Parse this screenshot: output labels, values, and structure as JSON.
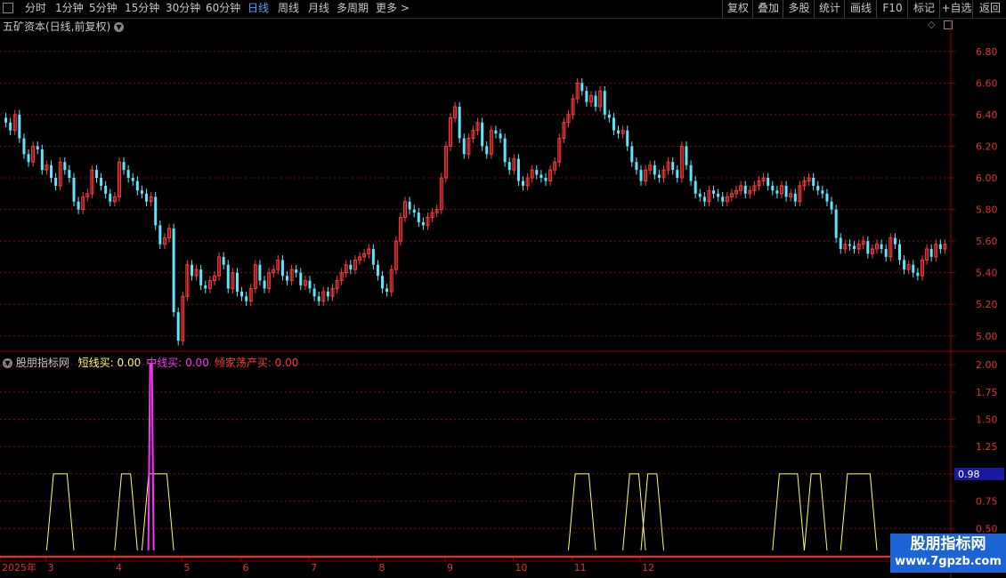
{
  "toolbar": {
    "left_items": [
      "分时",
      "1分钟",
      "5分钟",
      "15分钟",
      "30分钟",
      "60分钟",
      "日线",
      "周线",
      "月线",
      "多周期",
      "更多 >"
    ],
    "active": "日线",
    "right_items": [
      "复权",
      "叠加",
      "多股",
      "统计",
      "画线",
      "F10",
      "标记",
      "+自选",
      "返回"
    ]
  },
  "main_chart": {
    "title": "五矿资本(日线,前复权)",
    "y_ticks": [
      "6.80",
      "6.60",
      "6.40",
      "6.20",
      "6.00",
      "5.80",
      "5.60",
      "5.40",
      "5.20",
      "5.00"
    ],
    "ylim": [
      4.92,
      6.9
    ],
    "up_color": "#ff3b3b",
    "down_color": "#5ee6ff"
  },
  "indicator": {
    "name": "股朋指标网",
    "items": [
      {
        "label": "短线买: 0.00",
        "color": "#ffff66"
      },
      {
        "label": "中线买: 0.00",
        "color": "#ff33ff"
      },
      {
        "label": "倾家荡产买: 0.00",
        "color": "#ff3b3b"
      }
    ],
    "y_ticks": [
      "2.00",
      "1.75",
      "1.50",
      "1.25",
      "1.00",
      "0.75",
      "0.50"
    ],
    "current_value": "0.98",
    "ylim": [
      0.25,
      2.05
    ]
  },
  "x_axis": {
    "labels": [
      "2025年",
      "3",
      "4",
      "5",
      "6",
      "7",
      "8",
      "9",
      "10",
      "11",
      "12"
    ],
    "bar_index": [
      0,
      10,
      25,
      40,
      53,
      68,
      83,
      98,
      113,
      126,
      141
    ]
  },
  "watermark": {
    "name": "股朋指标网",
    "url": "www.7gpzb.com"
  },
  "chart_data": [
    {
      "type": "candlestick",
      "title": "五矿资本(日线,前复权)",
      "ylim": [
        4.92,
        6.9
      ],
      "closes": [
        6.35,
        6.3,
        6.4,
        6.25,
        6.15,
        6.1,
        6.2,
        6.18,
        6.05,
        6.08,
        6.0,
        5.95,
        6.1,
        6.05,
        6.0,
        5.85,
        5.8,
        5.88,
        5.9,
        6.05,
        6.0,
        5.95,
        5.9,
        5.85,
        5.88,
        6.1,
        6.05,
        6.0,
        5.98,
        5.92,
        5.9,
        5.85,
        5.88,
        5.7,
        5.58,
        5.62,
        5.68,
        5.15,
        4.97,
        5.25,
        5.45,
        5.38,
        5.42,
        5.32,
        5.3,
        5.35,
        5.38,
        5.5,
        5.45,
        5.3,
        5.4,
        5.28,
        5.25,
        5.22,
        5.3,
        5.45,
        5.35,
        5.3,
        5.4,
        5.42,
        5.48,
        5.38,
        5.35,
        5.42,
        5.4,
        5.32,
        5.35,
        5.3,
        5.25,
        5.22,
        5.28,
        5.25,
        5.3,
        5.35,
        5.4,
        5.45,
        5.42,
        5.48,
        5.5,
        5.52,
        5.55,
        5.45,
        5.38,
        5.3,
        5.28,
        5.42,
        5.6,
        5.75,
        5.85,
        5.8,
        5.78,
        5.72,
        5.7,
        5.75,
        5.78,
        5.8,
        6.0,
        6.2,
        6.38,
        6.45,
        6.25,
        6.15,
        6.25,
        6.3,
        6.35,
        6.2,
        6.15,
        6.3,
        6.28,
        6.25,
        6.1,
        6.05,
        6.12,
        5.98,
        5.95,
        6.0,
        6.05,
        6.02,
        6.0,
        5.98,
        6.05,
        6.1,
        6.25,
        6.35,
        6.4,
        6.5,
        6.6,
        6.55,
        6.48,
        6.52,
        6.45,
        6.55,
        6.4,
        6.38,
        6.3,
        6.28,
        6.3,
        6.2,
        6.1,
        6.05,
        5.98,
        6.05,
        6.08,
        6.02,
        6.0,
        6.05,
        6.1,
        6.05,
        6.0,
        6.2,
        6.08,
        5.98,
        5.9,
        5.88,
        5.85,
        5.92,
        5.9,
        5.88,
        5.85,
        5.88,
        5.9,
        5.92,
        5.95,
        5.9,
        5.92,
        5.95,
        5.98,
        6.0,
        5.95,
        5.92,
        5.9,
        5.95,
        5.88,
        5.9,
        5.85,
        5.95,
        5.98,
        6.0,
        5.95,
        5.92,
        5.9,
        5.85,
        5.8,
        5.62,
        5.55,
        5.58,
        5.57,
        5.55,
        5.58,
        5.6,
        5.52,
        5.55,
        5.58,
        5.55,
        5.5,
        5.62,
        5.58,
        5.48,
        5.42,
        5.45,
        5.4,
        5.38,
        5.48,
        5.55,
        5.5,
        5.58,
        5.55,
        5.58
      ]
    },
    {
      "type": "step",
      "series": [
        {
          "name": "短线买",
          "x_ranges": [
            [
              10,
              14
            ],
            [
              25,
              28
            ],
            [
              31,
              36
            ],
            [
              125,
              129
            ],
            [
              137,
              140
            ],
            [
              141,
              144
            ],
            [
              170,
              175
            ],
            [
              177,
              180
            ],
            [
              185,
              191
            ]
          ],
          "high": 1.0,
          "low": 0.0
        },
        {
          "name": "中线买",
          "spike_at": 32,
          "value": 2.0
        }
      ],
      "ylim": [
        0.25,
        2.05
      ]
    }
  ]
}
